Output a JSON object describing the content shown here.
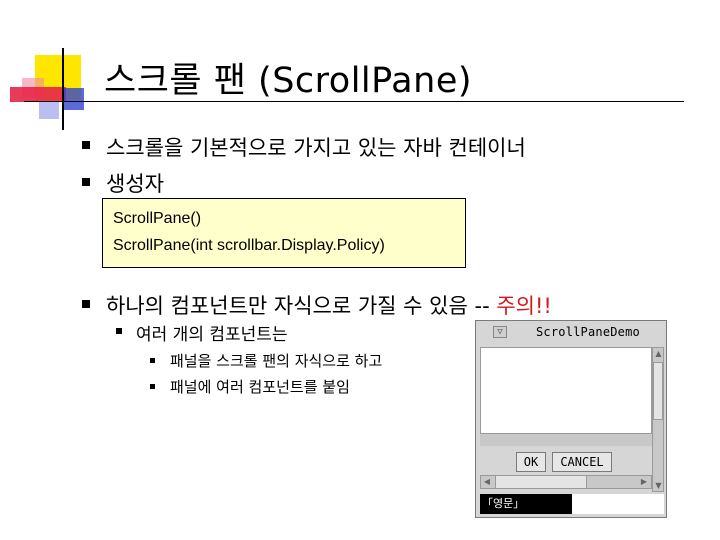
{
  "slide": {
    "title": "스크롤 팬 (ScrollPane)",
    "bullets": [
      "스크롤을 기본적으로 가지고 있는 자바 컨테이너",
      "생성자"
    ],
    "code_lines": [
      "ScrollPane()",
      "ScrollPane(int scrollbar.Display.Policy)"
    ],
    "bullet3_text": "하나의 컴포넌트만 자식으로 가질 수 있음 -- ",
    "bullet3_caution": "주의!!",
    "sub_bullet": "여러 개의 컴포넌트는",
    "sub_sub_bullets": [
      "패널을 스크롤 팬의 자식으로 하고",
      "패널에 여러 컴포넌트를 붙임"
    ]
  },
  "window": {
    "title": "ScrollPaneDemo",
    "menu_glyph": "▽",
    "ok_label": "OK",
    "cancel_label": "CANCEL",
    "status_text": "「영문」",
    "up_arrow": "▲",
    "down_arrow": "▼",
    "left_arrow": "◀",
    "right_arrow": "▶"
  },
  "colors": {
    "accent_yellow": "#ffe600",
    "accent_red": "#e8254a",
    "accent_blue": "#3344cc",
    "code_bg": "#ffffcc",
    "caution": "#d11a1a"
  }
}
